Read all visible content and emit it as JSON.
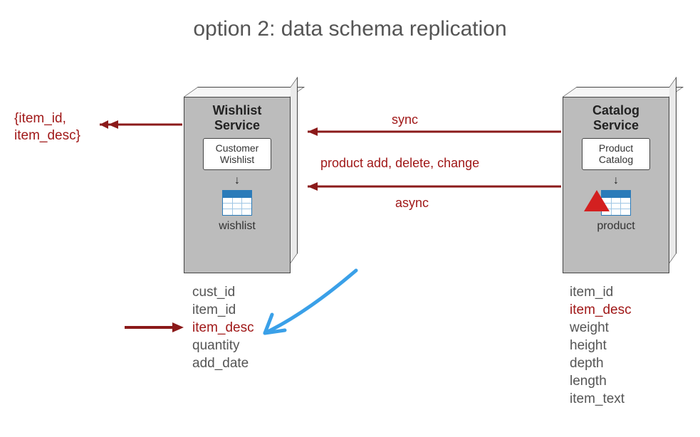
{
  "title": "option 2: data schema replication",
  "output": "{item_id,\n item_desc}",
  "arrows": {
    "sync": "sync",
    "event": "product add, delete, change",
    "async": "async"
  },
  "wishlist_service": {
    "title": "Wishlist Service",
    "component": "Customer Wishlist",
    "table": "wishlist",
    "fields": [
      "cust_id",
      "item_id",
      "item_desc",
      "quantity",
      "add_date"
    ],
    "highlight_field": "item_desc"
  },
  "catalog_service": {
    "title": "Catalog Service",
    "component": "Product Catalog",
    "table": "product",
    "fields": [
      "item_id",
      "item_desc",
      "weight",
      "height",
      "depth",
      "length",
      "item_text"
    ],
    "highlight_field": "item_desc"
  }
}
